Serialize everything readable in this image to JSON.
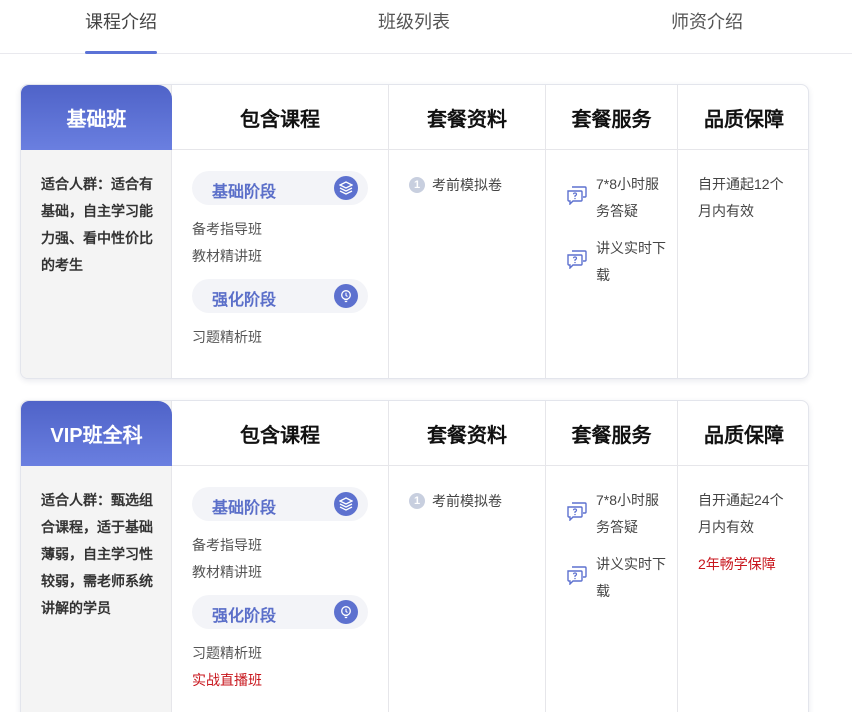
{
  "tabs": [
    {
      "label": "课程介绍",
      "active": true
    },
    {
      "label": "班级列表",
      "active": false
    },
    {
      "label": "师资介绍",
      "active": false
    }
  ],
  "headers": {
    "courses": "包含课程",
    "materials": "套餐资料",
    "services": "套餐服务",
    "quality": "品质保障"
  },
  "colors": {
    "accent": "#5b72d6",
    "red": "#c8161d"
  },
  "cards": [
    {
      "class_name": "基础班",
      "audience": "适合人群：适合有基础，自主学习能力强、看中性价比的考生",
      "stages": [
        {
          "label": "基础阶段",
          "icon": "layers-icon",
          "items": [
            "备考指导班",
            "教材精讲班"
          ]
        },
        {
          "label": "强化阶段",
          "icon": "bulb-icon",
          "items": [
            "习题精析班"
          ]
        }
      ],
      "materials": [
        {
          "num": "1",
          "label": "考前模拟卷"
        }
      ],
      "services": [
        {
          "icon": "chat-question-icon",
          "label": "7*8小时服务答疑"
        },
        {
          "icon": "chat-question-icon",
          "label": "讲义实时下载"
        }
      ],
      "quality": [
        "自开通起12个月内有效"
      ]
    },
    {
      "class_name": "VIP班全科",
      "audience": "适合人群：甄选组合课程，适于基础薄弱，自主学习性较弱，需老师系统讲解的学员",
      "stages": [
        {
          "label": "基础阶段",
          "icon": "layers-icon",
          "items": [
            "备考指导班",
            "教材精讲班"
          ]
        },
        {
          "label": "强化阶段",
          "icon": "bulb-icon",
          "items": [
            "习题精析班"
          ],
          "extra": "实战直播班"
        }
      ],
      "materials": [
        {
          "num": "1",
          "label": "考前模拟卷"
        }
      ],
      "services": [
        {
          "icon": "chat-question-icon",
          "label": "7*8小时服务答疑"
        },
        {
          "icon": "chat-question-icon",
          "label": "讲义实时下载"
        }
      ],
      "quality": [
        "自开通起24个月内有效"
      ],
      "quality_extra": "2年畅学保障"
    }
  ]
}
